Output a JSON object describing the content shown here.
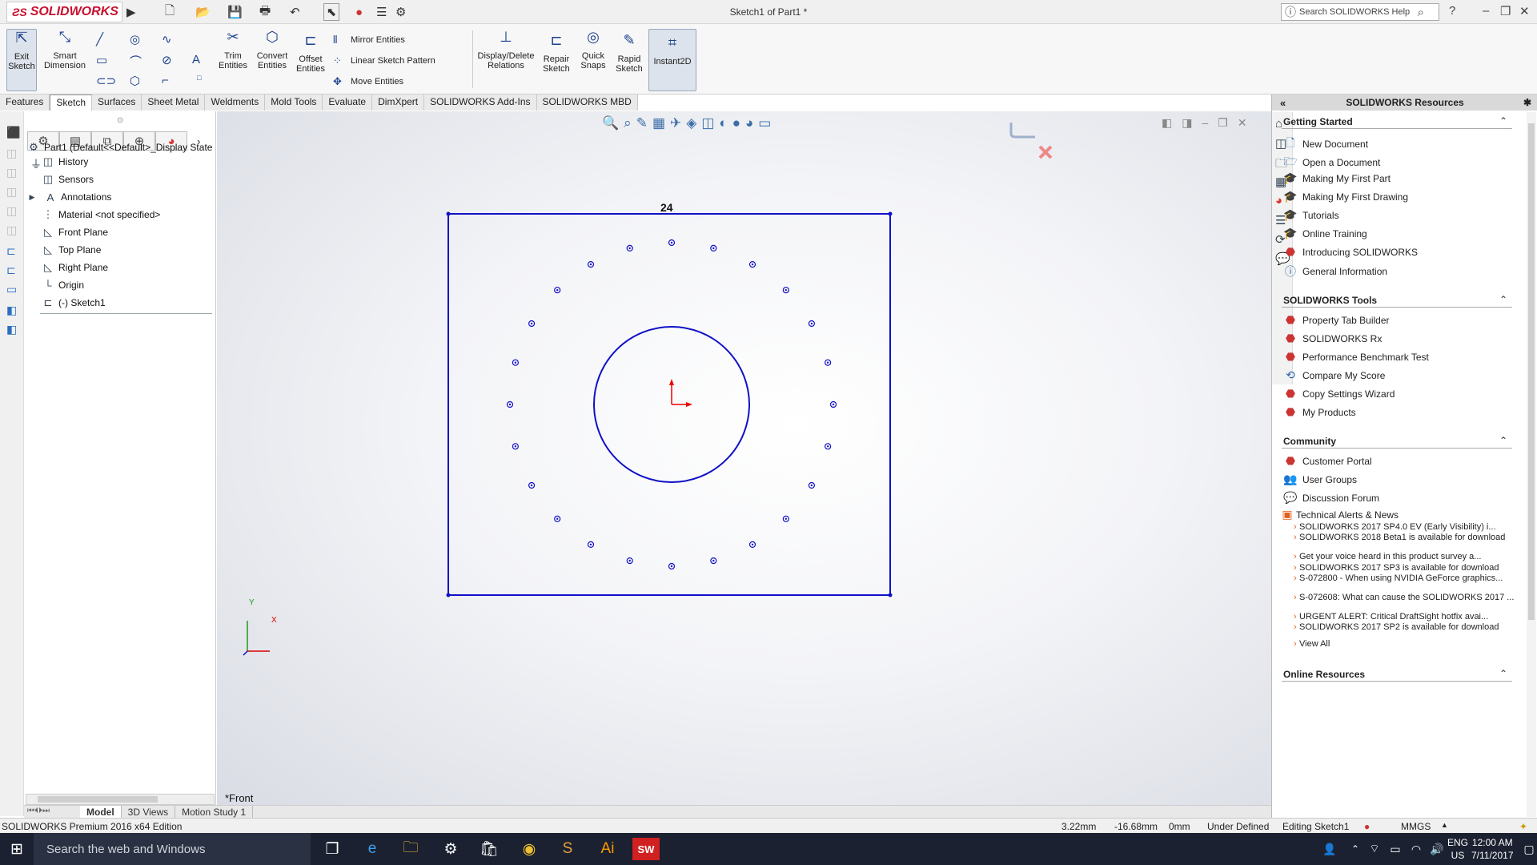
{
  "app": {
    "logo": "SOLIDWORKS",
    "doc_title": "Sketch1 of Part1 *",
    "search_placeholder": "Search SOLIDWORKS Help"
  },
  "ribbon": {
    "exit_sketch": "Exit\nSketch",
    "smart_dimension": "Smart\nDimension",
    "trim_entities": "Trim\nEntities",
    "convert_entities": "Convert\nEntities",
    "offset_entities": "Offset\nEntities",
    "mirror_entities": "Mirror Entities",
    "linear_sketch_pattern": "Linear Sketch Pattern",
    "move_entities": "Move Entities",
    "display_delete_relations": "Display/Delete\nRelations",
    "repair_sketch": "Repair\nSketch",
    "quick_snaps": "Quick\nSnaps",
    "rapid_sketch": "Rapid\nSketch",
    "instant2d": "Instant2D"
  },
  "tabs": [
    "Features",
    "Sketch",
    "Surfaces",
    "Sheet Metal",
    "Weldments",
    "Mold Tools",
    "Evaluate",
    "DimXpert",
    "SOLIDWORKS Add-Ins",
    "SOLIDWORKS MBD"
  ],
  "tree": {
    "root": "Part1  (Default<<Default>_Display State",
    "items": [
      "History",
      "Sensors",
      "Annotations",
      "Material <not specified>",
      "Front Plane",
      "Top Plane",
      "Right Plane",
      "Origin",
      "(-) Sketch1"
    ]
  },
  "canvas": {
    "pattern_count": "24",
    "view_label": "*Front",
    "axis_x": "X",
    "axis_y": "Y",
    "hole_count": 24
  },
  "bottom_tabs": [
    "Model",
    "3D Views",
    "Motion Study 1"
  ],
  "status": {
    "edition": "SOLIDWORKS Premium 2016 x64 Edition",
    "x": "3.22mm",
    "y": "-16.68mm",
    "z": "0mm",
    "state": "Under Defined",
    "editing": "Editing Sketch1",
    "units": "MMGS"
  },
  "resources": {
    "title": "SOLIDWORKS Resources",
    "getting_started": {
      "header": "Getting Started",
      "items": [
        "New Document",
        "Open a Document",
        "Making My First Part",
        "Making My First Drawing",
        "Tutorials",
        "Online Training",
        "Introducing SOLIDWORKS",
        "General Information"
      ]
    },
    "tools": {
      "header": "SOLIDWORKS Tools",
      "items": [
        "Property Tab Builder",
        "SOLIDWORKS Rx",
        "Performance Benchmark Test",
        "Compare My Score",
        "Copy Settings Wizard",
        "My Products"
      ]
    },
    "community": {
      "header": "Community",
      "items": [
        "Customer Portal",
        "User Groups",
        "Discussion Forum",
        "Technical Alerts & News"
      ]
    },
    "news": [
      "SOLIDWORKS 2017 SP4.0 EV (Early Visibility) i...",
      "SOLIDWORKS 2018 Beta1 is available for download",
      "Get your voice heard in this product survey a...",
      "SOLIDWORKS 2017 SP3 is available for download",
      "S-072800 - When using NVIDIA GeForce graphics...",
      "S-072608: What can cause the SOLIDWORKS 2017 ...",
      "URGENT ALERT: Critical DraftSight hotfix avai...",
      "SOLIDWORKS 2017 SP2 is available for download"
    ],
    "view_all": "View All",
    "online_resources": "Online Resources"
  },
  "taskbar": {
    "search": "Search the web and Windows",
    "lang1": "ENG",
    "lang2": "US",
    "time": "12:00 AM",
    "date": "7/11/2017"
  },
  "colors": {
    "sketch": "#0000cc",
    "accent": "#c8102e"
  }
}
